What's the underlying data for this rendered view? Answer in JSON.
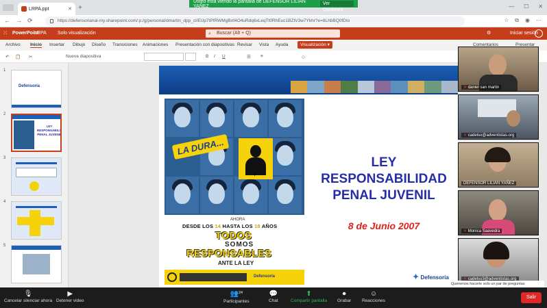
{
  "share_banner": {
    "text": "Usted está viendo la pantalla de DEFENSOR LILIAN YAÑEZ",
    "options_label": "Ver Opciones"
  },
  "browser": {
    "tab_title": "LRPA.ppt",
    "url": "https://defensorianal-my.sharepoint.com/:p:/g/personal/dmartin_dpp_cl/EUp7tPfRWMgBnf4O4uRdq6xLeqTt0RhEuc1BZtV3w7Ykhr?e=8LhbBQ0fDIo"
  },
  "ppt_header": {
    "app": "PowerPoint",
    "doc": "LRPA",
    "mode": "Solo visualización",
    "search_placeholder": "Buscar (Alt + Q)",
    "signin": "Iniciar sesión"
  },
  "ribbon": {
    "tabs": [
      "Archivo",
      "Inicio",
      "Insertar",
      "Dibujo",
      "Diseño",
      "Transiciones",
      "Animaciones",
      "Presentación con diapositivas",
      "Revisar",
      "Vista",
      "Ayuda"
    ],
    "active_tab": "Inicio",
    "view_button": "Visualización",
    "comments": "Comentarios",
    "present": "Presentar"
  },
  "toolbar": {
    "new_slide": "Nueva diapositiva"
  },
  "thumbnails": [
    "1",
    "2",
    "3",
    "4",
    "5"
  ],
  "slide": {
    "badge": "LA DURA...",
    "silhouette_mark": "?",
    "ahora": "AHORA",
    "desde": [
      "DESDE LOS ",
      "14",
      " HASTA LOS ",
      "18",
      " AÑOS"
    ],
    "todos": "TODOS",
    "somos": "SOMOS",
    "responsables": "RESPONSABLES",
    "ante": "ANTE LA LEY",
    "strip_logo": "Defensoría",
    "title_lines": [
      "LEY",
      "RESPONSABILIDAD",
      "PENAL JUVENIL"
    ],
    "date": "8 de Junio 2007",
    "logo": "Defensoría"
  },
  "participants": [
    {
      "name": "daniel san martin",
      "muted": true
    },
    {
      "name": "cadelso@adventistas.org",
      "muted": true
    },
    {
      "name": "DEFENSOR LILIAN YAÑEZ",
      "muted": false
    },
    {
      "name": "Monica Saavedra",
      "muted": true
    },
    {
      "name": "cadelso3@adventistas.org",
      "muted": true
    }
  ],
  "chat_preview": "Queremos hacerle solo un par de preguntas",
  "controls": {
    "mute": "Cancelar silenciar ahora",
    "video": "Detener video",
    "participants": "Participantes",
    "participants_count": "24",
    "chat": "Chat",
    "share": "Compartir pantalla",
    "record": "Grabar",
    "reactions": "Reacciones",
    "leave": "Salir"
  },
  "colors": {
    "ppt_brand": "#c43e1c",
    "title_blue": "#262da6",
    "date_red": "#e0201a",
    "share_green": "#1f9e4a"
  }
}
